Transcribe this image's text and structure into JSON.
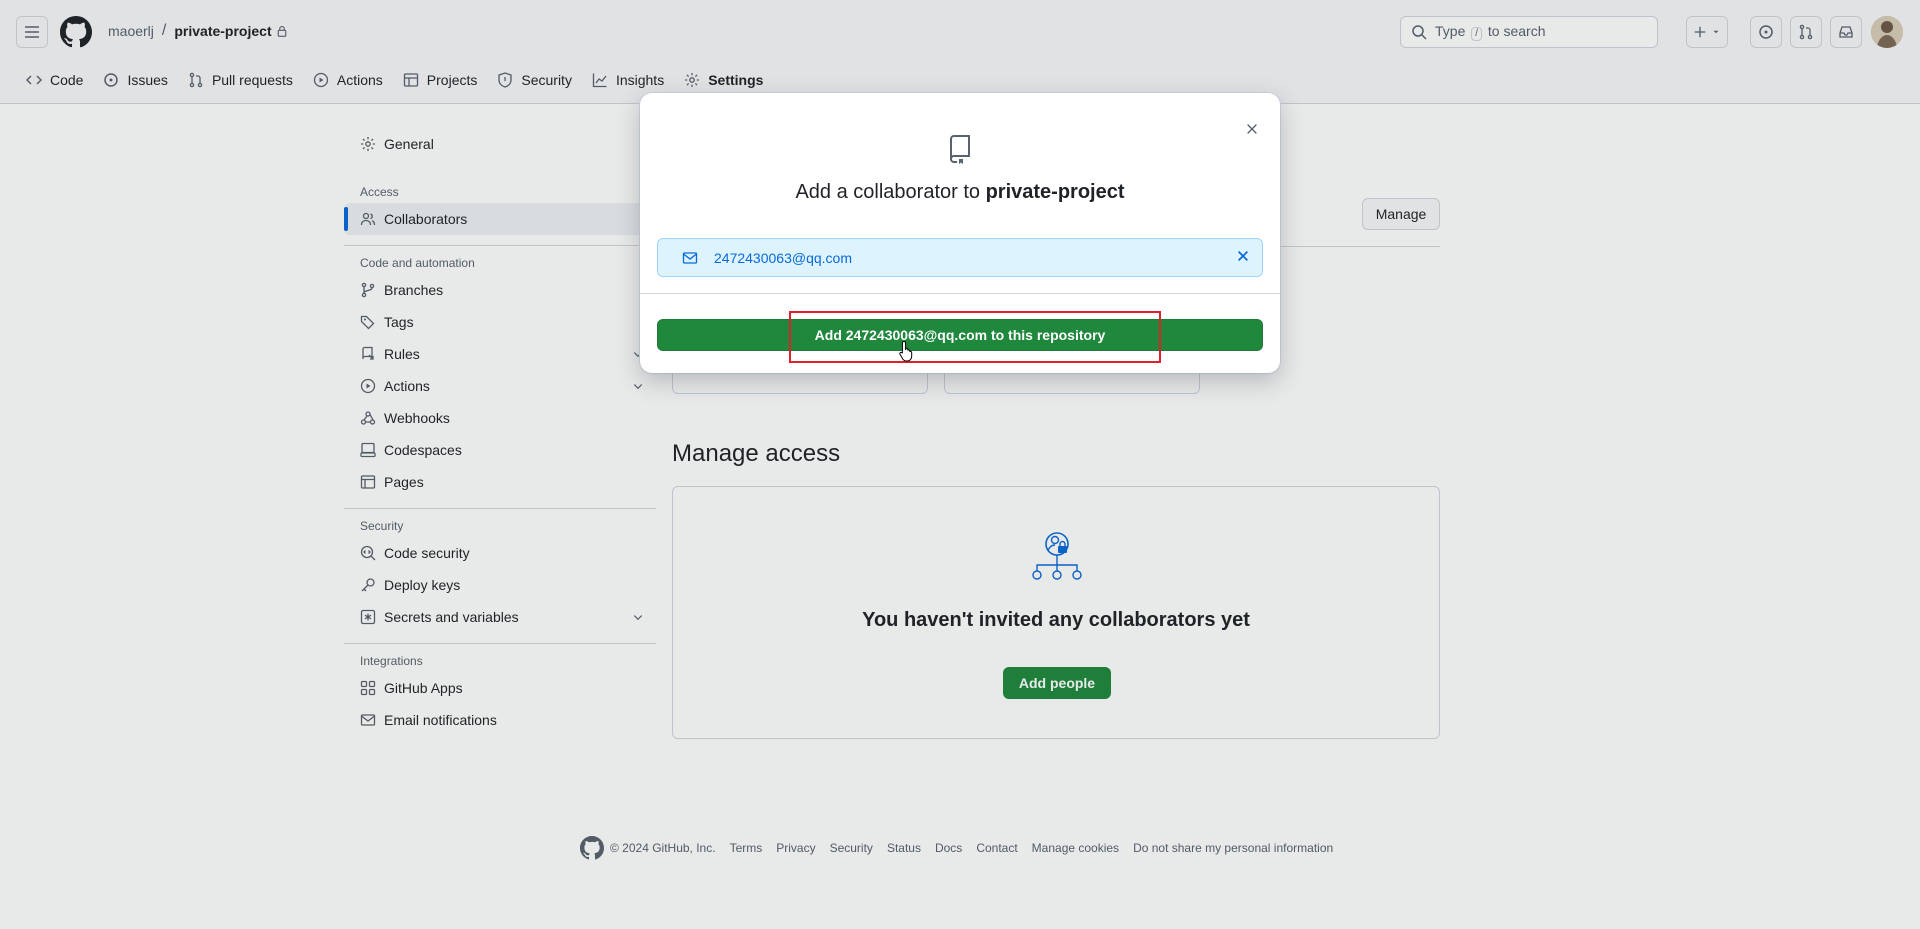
{
  "header": {
    "owner": "maoerlj",
    "separator": "/",
    "repo": "private-project",
    "search": {
      "type_text": "Type",
      "key": "/",
      "suffix": "to search"
    }
  },
  "repo_nav": [
    {
      "label": "Code",
      "icon": "code-icon"
    },
    {
      "label": "Issues",
      "icon": "issue-icon"
    },
    {
      "label": "Pull requests",
      "icon": "pull-request-icon"
    },
    {
      "label": "Actions",
      "icon": "play-icon"
    },
    {
      "label": "Projects",
      "icon": "table-icon"
    },
    {
      "label": "Security",
      "icon": "shield-icon"
    },
    {
      "label": "Insights",
      "icon": "graph-icon"
    },
    {
      "label": "Settings",
      "icon": "gear-icon"
    }
  ],
  "sidebar": {
    "general": "General",
    "access_heading": "Access",
    "collaborators": "Collaborators",
    "code_heading": "Code and automation",
    "branches": "Branches",
    "tags": "Tags",
    "rules": "Rules",
    "actions": "Actions",
    "webhooks": "Webhooks",
    "codespaces": "Codespaces",
    "pages": "Pages",
    "security_heading": "Security",
    "code_security": "Code security",
    "deploy_keys": "Deploy keys",
    "secrets": "Secrets and variables",
    "integrations_heading": "Integrations",
    "github_apps": "GitHub Apps",
    "email_notifications": "Email notifications"
  },
  "main": {
    "manage_button": "Manage",
    "manage_access_title": "Manage access",
    "empty_title": "You haven't invited any collaborators yet",
    "add_people": "Add people"
  },
  "dialog": {
    "title_prefix": "Add a collaborator to",
    "title_repo": "private-project",
    "chip_email": "2472430063@qq.com",
    "submit_label": "Add 2472430063@qq.com to this repository"
  },
  "footer": {
    "copyright": "© 2024 GitHub, Inc.",
    "links": [
      "Terms",
      "Privacy",
      "Security",
      "Status",
      "Docs",
      "Contact",
      "Manage cookies",
      "Do not share my personal information"
    ]
  },
  "colors": {
    "primary_green": "#1f883d",
    "link_blue": "#0969da",
    "highlight_red": "#e0202a"
  }
}
